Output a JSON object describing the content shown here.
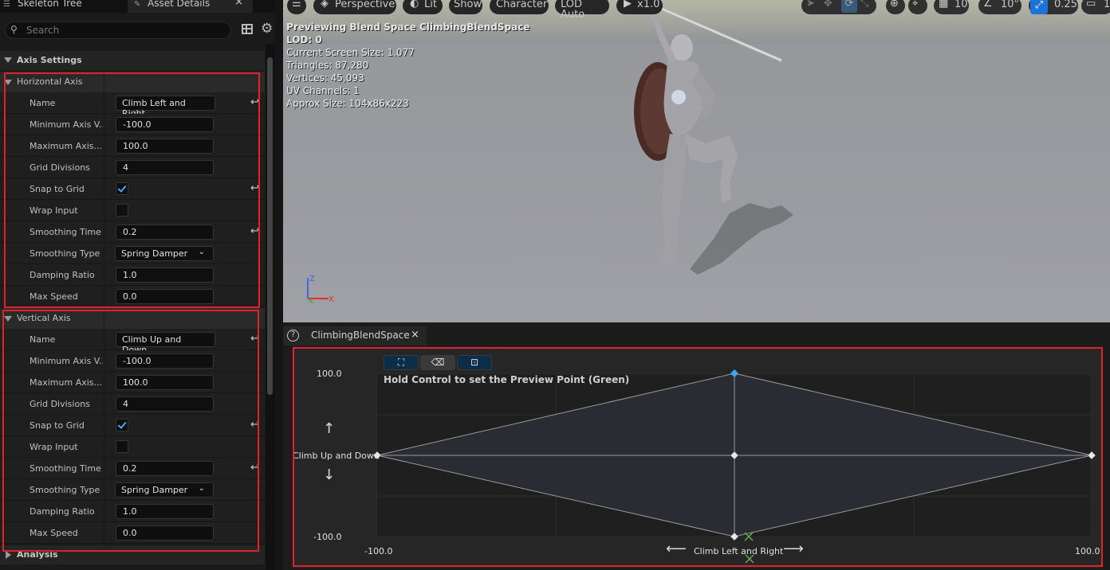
{
  "tabs": {
    "skeleton_tree": "Skeleton Tree",
    "asset_details": "Asset Details",
    "close": "×"
  },
  "search": {
    "placeholder": "Search"
  },
  "axis_settings": {
    "title": "Axis Settings",
    "horizontal": {
      "title": "Horizontal Axis",
      "rows": {
        "name": {
          "label": "Name",
          "value": "Climb Left and Right"
        },
        "min": {
          "label": "Minimum Axis V...",
          "value": "-100.0"
        },
        "max": {
          "label": "Maximum Axis...",
          "value": "100.0"
        },
        "grid": {
          "label": "Grid Divisions",
          "value": "4"
        },
        "snap": {
          "label": "Snap to Grid",
          "checked": true
        },
        "wrap": {
          "label": "Wrap Input",
          "checked": false
        },
        "smooth_time": {
          "label": "Smoothing Time",
          "value": "0.2"
        },
        "smooth_type": {
          "label": "Smoothing Type",
          "value": "Spring Damper"
        },
        "damping": {
          "label": "Damping Ratio",
          "value": "1.0"
        },
        "max_speed": {
          "label": "Max Speed",
          "value": "0.0"
        }
      }
    },
    "vertical": {
      "title": "Vertical Axis",
      "rows": {
        "name": {
          "label": "Name",
          "value": "Climb Up and Down"
        },
        "min": {
          "label": "Minimum Axis V...",
          "value": "-100.0"
        },
        "max": {
          "label": "Maximum Axis...",
          "value": "100.0"
        },
        "grid": {
          "label": "Grid Divisions",
          "value": "4"
        },
        "snap": {
          "label": "Snap to Grid",
          "checked": true
        },
        "wrap": {
          "label": "Wrap Input",
          "checked": false
        },
        "smooth_time": {
          "label": "Smoothing Time",
          "value": "0.2"
        },
        "smooth_type": {
          "label": "Smoothing Type",
          "value": "Spring Damper"
        },
        "damping": {
          "label": "Damping Ratio",
          "value": "1.0"
        },
        "max_speed": {
          "label": "Max Speed",
          "value": "0.0"
        }
      }
    },
    "analysis": "Analysis"
  },
  "viewport": {
    "toolbar": {
      "perspective": "Perspective",
      "lit": "Lit",
      "show": "Show",
      "character": "Character",
      "lod": "LOD Auto",
      "speed": "x1.0",
      "grid_value": "10",
      "angle_value": "10°",
      "scale_value": "0.25",
      "camera_value": "1"
    },
    "overlay": {
      "line1": "Previewing Blend Space ClimbingBlendSpace",
      "line2": "LOD: 0",
      "line3": "Current Screen Size: 1.077",
      "line4": "Triangles: 87,280",
      "line5": "Vertices: 45,093",
      "line6": "UV Channels: 1",
      "line7": "Approx Size: 104x86x223"
    },
    "gizmo": {
      "z": "Z",
      "x": "X"
    }
  },
  "blendspace": {
    "tab_label": "ClimbingBlendSpace",
    "help": "?",
    "close": "×",
    "hint": "Hold Control to set the Preview Point (Green)",
    "y_max": "100.0",
    "y_min": "-100.0",
    "x_min": "-100.0",
    "x_max": "100.0",
    "y_axis_name": "Climb Up and Down",
    "x_axis_name": "Climb Left and Right",
    "colors": {
      "highlight": "#e0222a",
      "selected_point": "#3aa8ff",
      "preview": "#6aa84f"
    }
  }
}
